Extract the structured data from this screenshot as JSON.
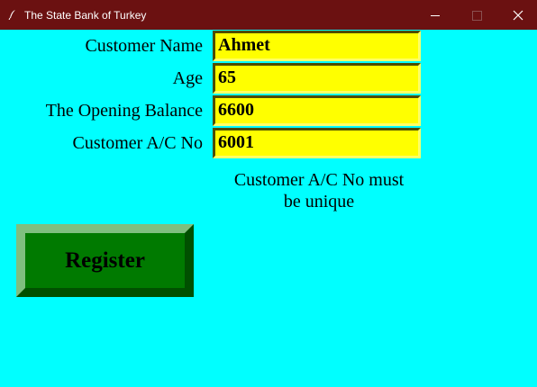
{
  "window": {
    "title": "The State Bank of Turkey",
    "icon": "feather-icon",
    "controls": [
      "minimize-icon",
      "maximize-icon",
      "close-icon"
    ],
    "titlebar_color": "#6b1111"
  },
  "form": {
    "background_color": "#00ffff",
    "fields": [
      {
        "label": "Customer Name",
        "value": "Ahmet"
      },
      {
        "label": "Age",
        "value": "65"
      },
      {
        "label": "The Opening Balance",
        "value": "6600"
      },
      {
        "label": "Customer A/C No",
        "value": "6001"
      }
    ],
    "entry_color": "#ffff00",
    "note_line1": "Customer A/C No must",
    "note_line2": "be unique",
    "register_label": "Register",
    "register_color": "#007a00"
  }
}
